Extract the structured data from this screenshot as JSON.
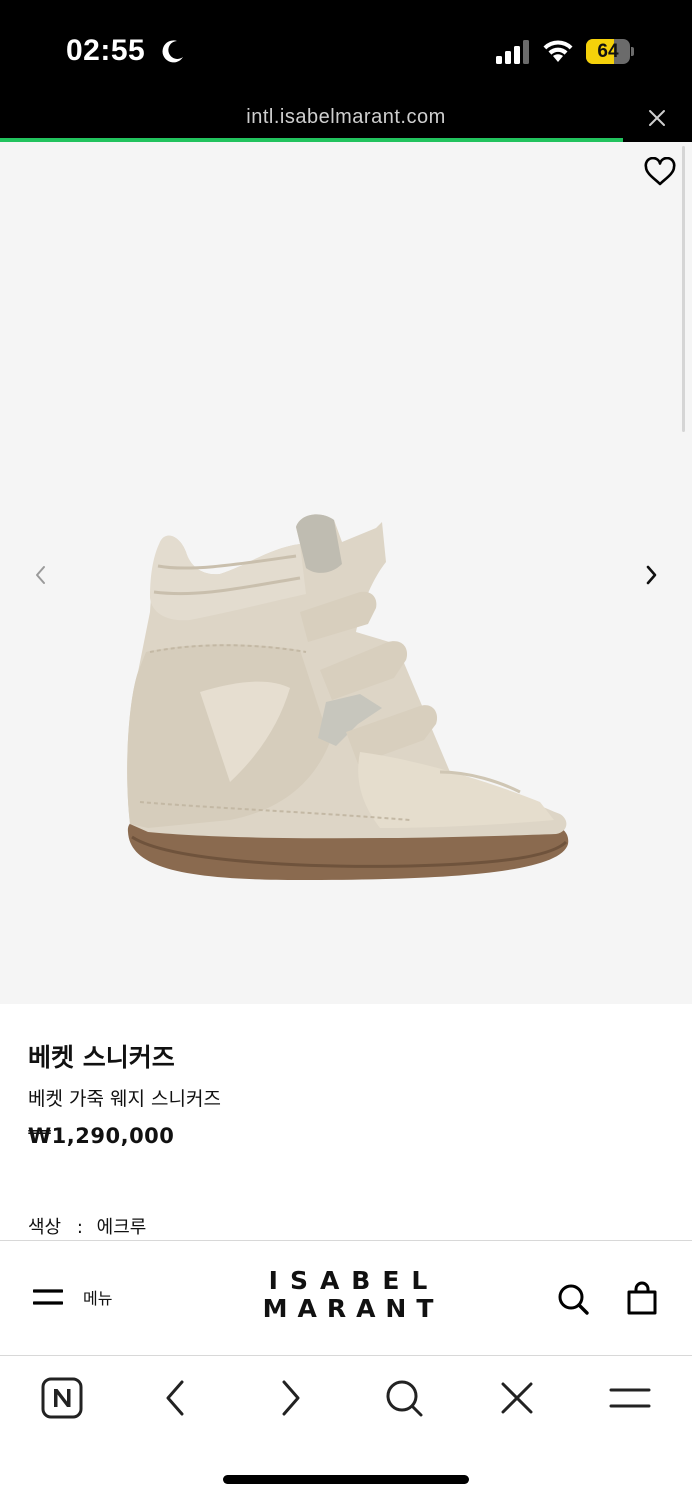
{
  "status_bar": {
    "time": "02:55",
    "battery_level": "64",
    "battery_fraction": 0.64,
    "battery_color": "#f5d10a",
    "icons": [
      "moon-icon",
      "cellular-signal-icon",
      "wifi-icon",
      "battery-icon"
    ]
  },
  "browser": {
    "url": "intl.isabelmarant.com",
    "load_progress": 0.9,
    "load_color": "#22c35e",
    "close_icon": "close-icon"
  },
  "gallery": {
    "background": "#f5f5f5",
    "image_subject": "shoe-image",
    "wishlist_icon": "heart-icon",
    "prev_icon": "chevron-left-icon",
    "next_icon": "chevron-right-icon"
  },
  "product": {
    "title": "베켓 스니커즈",
    "subtitle": "베켓 가죽 웨지 스니커즈",
    "price": "₩1,290,000",
    "color_label": "색상",
    "color_separator": ":",
    "color_value": "에크루"
  },
  "site_header": {
    "menu_label": "메뉴",
    "brand_line1": "ISABEL",
    "brand_line2": "MARANT",
    "icons": [
      "menu-icon",
      "search-icon",
      "shopping-bag-icon"
    ]
  },
  "browser_toolbar": {
    "icons": [
      "naver-home-icon",
      "back-icon",
      "forward-icon",
      "search-icon",
      "close-icon",
      "menu-icon"
    ]
  }
}
